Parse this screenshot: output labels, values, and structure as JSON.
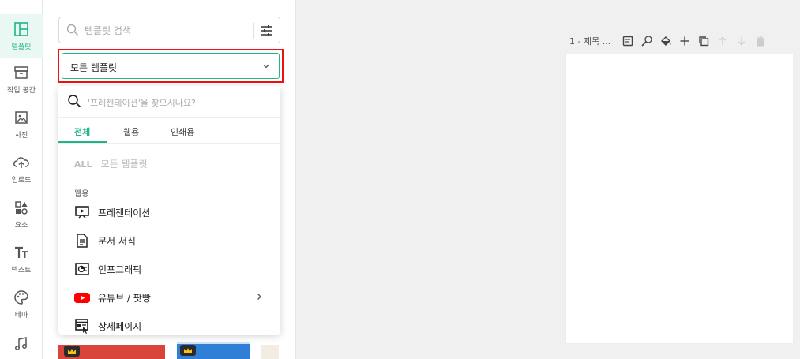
{
  "rail": {
    "items": [
      {
        "label": "템플릿",
        "icon": "layout-icon"
      },
      {
        "label": "작업 공간",
        "icon": "archive-box-icon"
      },
      {
        "label": "사진",
        "icon": "image-icon"
      },
      {
        "label": "업로드",
        "icon": "cloud-upload-icon"
      },
      {
        "label": "요소",
        "icon": "shapes-icon"
      },
      {
        "label": "텍스트",
        "icon": "text-icon"
      },
      {
        "label": "테마",
        "icon": "palette-icon"
      }
    ]
  },
  "panel": {
    "search_placeholder": "템플릿 검색",
    "select_value": "모든 템플릿"
  },
  "dropdown": {
    "search_placeholder": "'프레젠테이션'을 찾으시나요?",
    "tabs": [
      "전체",
      "웹용",
      "인쇄용"
    ],
    "all_badge": "ALL",
    "all_label": "모든 템플릿",
    "section_label": "웹용",
    "items": [
      {
        "label": "프레젠테이션",
        "icon": "presentation-icon"
      },
      {
        "label": "문서 서식",
        "icon": "document-icon"
      },
      {
        "label": "인포그래픽",
        "icon": "infographic-icon"
      },
      {
        "label": "유튜브 / 팟빵",
        "icon": "youtube-icon"
      },
      {
        "label": "상세페이지",
        "icon": "detail-page-icon"
      }
    ]
  },
  "toolbar": {
    "title": "1 - 제목 ..."
  },
  "colors": {
    "accent": "#1fb589",
    "highlight": "#ee1111"
  }
}
